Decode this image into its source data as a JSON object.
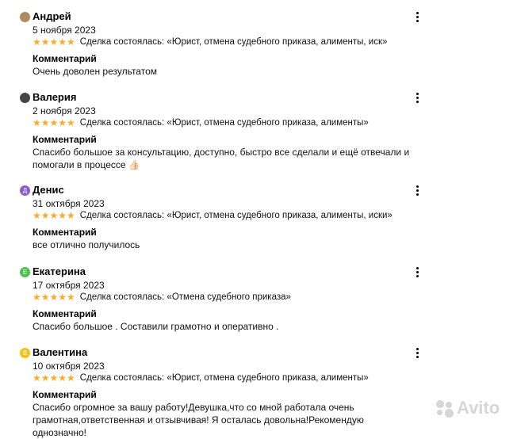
{
  "reviews": [
    {
      "name": "Андрей",
      "date": "5 ноября 2023",
      "stars": "★★★★★",
      "rating": 5,
      "deal": "Сделка состоялась: «Юрист, отмена судебного приказа, алименты, иск»",
      "comment_label": "Комментарий",
      "comment": "Очень доволен результатом",
      "avatar_color": "#b08a5a",
      "avatar_letter": ""
    },
    {
      "name": "Валерия",
      "date": "2 ноября 2023",
      "stars": "★★★★★",
      "rating": 5,
      "deal": "Сделка состоялась: «Юрист, отмена судебного приказа, алименты»",
      "comment_label": "Комментарий",
      "comment": "Спасибо большое за консультацию, доступно, быстро все сделали и ещё отвечали и помогали в процессе 👍🏻",
      "avatar_color": "#444444",
      "avatar_letter": ""
    },
    {
      "name": "Денис",
      "date": "31 октября 2023",
      "stars": "★★★★★",
      "rating": 5,
      "deal": "Сделка состоялась: «Юрист, отмена судебного приказа, алименты, иски»",
      "comment_label": "Комментарий",
      "comment": "все отлично получилось",
      "avatar_color": "#8a5cd1",
      "avatar_letter": "Д"
    },
    {
      "name": "Екатерина",
      "date": "17 октября 2023",
      "stars": "★★★★★",
      "rating": 5,
      "deal": "Сделка состоялась: «Отмена судебного приказа»",
      "comment_label": "Комментарий",
      "comment": "Спасибо большое . Составили грамотно и оперативно .",
      "avatar_color": "#4cc24c",
      "avatar_letter": "Е"
    },
    {
      "name": "Валентина",
      "date": "10 октября 2023",
      "stars": "★★★★★",
      "rating": 5,
      "deal": "Сделка состоялась: «Юрист, отмена судебного приказа, алименты»",
      "comment_label": "Комментарий",
      "comment": "Спасибо огромное за вашу работу!Девушка,что со мной работала очень грамотная,ответственная и отзывчивая! Я осталась довольна!Рекомендую однозначно!",
      "avatar_color": "#f2c21b",
      "avatar_letter": "В"
    }
  ],
  "watermark": "Avito",
  "colors": {
    "star": "#ffa928",
    "text": "#000000",
    "watermark": "#d2d2d2"
  },
  "icons": {
    "more": "more-vertical-icon",
    "star": "star-icon"
  }
}
